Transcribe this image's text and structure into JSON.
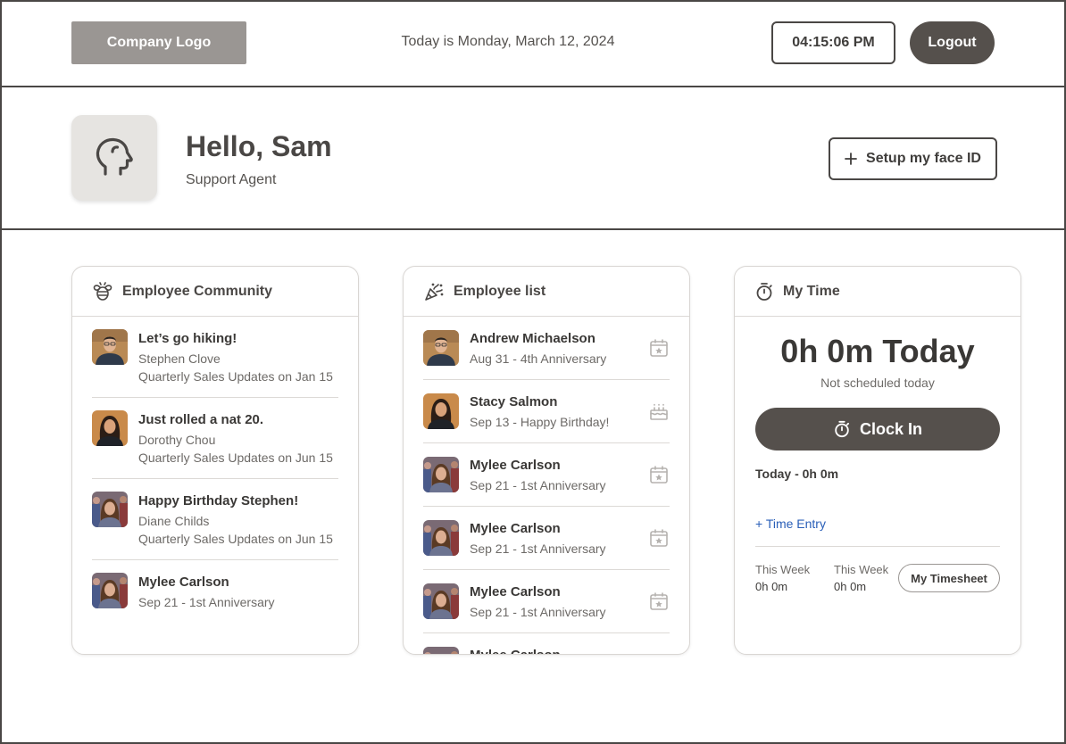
{
  "header": {
    "logo_label": "Company Logo",
    "date_text": "Today is Monday, March 12, 2024",
    "clock": "04:15:06 PM",
    "logout_label": "Logout"
  },
  "profile": {
    "greeting": "Hello, Sam",
    "role": "Support Agent",
    "face_id_label": "Setup my face ID"
  },
  "community": {
    "title": "Employee Community",
    "items": [
      {
        "title": "Let’s go hiking!",
        "author": "Stephen Clove",
        "note": "Quarterly Sales Updates on Jan 15",
        "photo": "man-glasses"
      },
      {
        "title": "Just rolled a nat 20.",
        "author": "Dorothy Chou",
        "note": "Quarterly Sales Updates on Jun 15",
        "photo": "woman-dark-hair"
      },
      {
        "title": "Happy Birthday Stephen!",
        "author": "Diane Childs",
        "note": "Quarterly Sales Updates on Jun 15",
        "photo": "woman-crowd"
      },
      {
        "title": "Mylee Carlson",
        "author": "Sep 21 - 1st Anniversary",
        "note": "",
        "photo": "woman-crowd"
      }
    ]
  },
  "employees": {
    "title": "Employee list",
    "items": [
      {
        "name": "Andrew Michaelson",
        "detail": "Aug 31 - 4th Anniversary",
        "icon": "calendar-star-icon",
        "photo": "man-glasses"
      },
      {
        "name": "Stacy Salmon",
        "detail": "Sep 13 - Happy Birthday!",
        "icon": "cake-icon",
        "photo": "woman-dark-hair"
      },
      {
        "name": "Mylee Carlson",
        "detail": "Sep 21 - 1st Anniversary",
        "icon": "calendar-star-icon",
        "photo": "woman-crowd"
      },
      {
        "name": "Mylee Carlson",
        "detail": "Sep 21 - 1st Anniversary",
        "icon": "calendar-star-icon",
        "photo": "woman-crowd"
      },
      {
        "name": "Mylee Carlson",
        "detail": "Sep 21 - 1st Anniversary",
        "icon": "calendar-star-icon",
        "photo": "woman-crowd"
      },
      {
        "name": "Mylee Carlson",
        "detail": "",
        "icon": "calendar-star-icon",
        "photo": "woman-crowd"
      }
    ]
  },
  "my_time": {
    "title": "My Time",
    "today_total": "0h 0m Today",
    "schedule_status": "Not scheduled today",
    "clock_in_label": "Clock In",
    "today_line": "Today - 0h 0m",
    "time_entry_label": "+ Time Entry",
    "weeks": [
      {
        "label": "This Week",
        "value": "0h 0m"
      },
      {
        "label": "This Week",
        "value": "0h 0m"
      }
    ],
    "timesheet_label": "My Timesheet"
  },
  "colors": {
    "dark_button": "#55504c",
    "logo_bg": "#9a9693",
    "link": "#2a5fb8"
  }
}
